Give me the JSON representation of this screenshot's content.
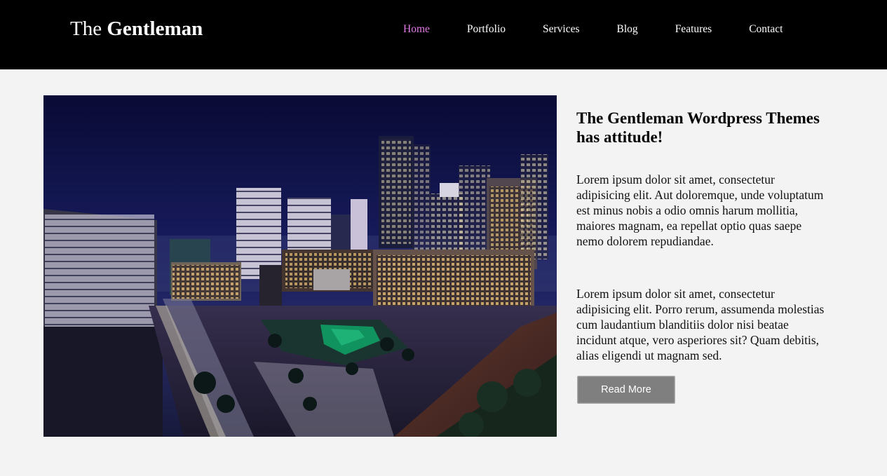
{
  "header": {
    "brand_light": "The ",
    "brand_bold": "Gentleman",
    "nav": [
      {
        "label": "Home",
        "active": true
      },
      {
        "label": "Portfolio",
        "active": false
      },
      {
        "label": "Services",
        "active": false
      },
      {
        "label": "Blog",
        "active": false
      },
      {
        "label": "Features",
        "active": false
      },
      {
        "label": "Contact",
        "active": false
      }
    ]
  },
  "main": {
    "headline": "The Gentleman Wordpress Themes has attitude!",
    "paragraph_1": "Lorem ipsum dolor sit amet, consectetur adipisicing elit. Aut doloremque, unde voluptatum est minus nobis a odio omnis harum mollitia, maiores magnam, ea repellat optio quas saepe nemo dolorem repudiandae.",
    "paragraph_2": "Lorem ipsum dolor sit amet, consectetur adipisicing elit. Porro rerum, assumenda molestias cum laudantium blanditiis dolor nisi beatae incidunt atque, vero asperiores sit? Quam debitis, alias eligendi ut magnam sed.",
    "read_more_label": "Read More"
  },
  "colors": {
    "header_bg": "#000000",
    "nav_active": "#e07ae6",
    "page_bg": "#f3f3f3",
    "button_bg": "#7f7f7f"
  }
}
